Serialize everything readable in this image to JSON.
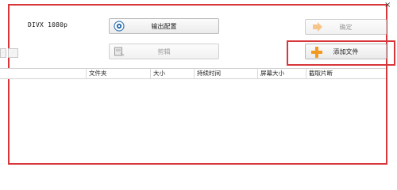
{
  "window": {
    "close_glyph": "×"
  },
  "format_label": "DIVX 1080p",
  "buttons": {
    "output_config": "输出配置",
    "edit": "剪辑",
    "confirm": "确定",
    "add_file": "添加文件"
  },
  "toolbar_mini": {
    "item1": "·",
    "item2": "·"
  },
  "table": {
    "columns": [
      "",
      "文件夹",
      "大小",
      "持续时间",
      "屏幕大小",
      "截取片断"
    ]
  },
  "colors": {
    "highlight_border": "#d8363a",
    "add_icon_orange": "#f39a1e",
    "confirm_icon_orange": "#f7c48a"
  },
  "icons": {
    "output_config": "gear-disc-icon",
    "edit": "film-edit-icon",
    "confirm": "arrow-right-icon",
    "add_file": "plus-icon"
  }
}
